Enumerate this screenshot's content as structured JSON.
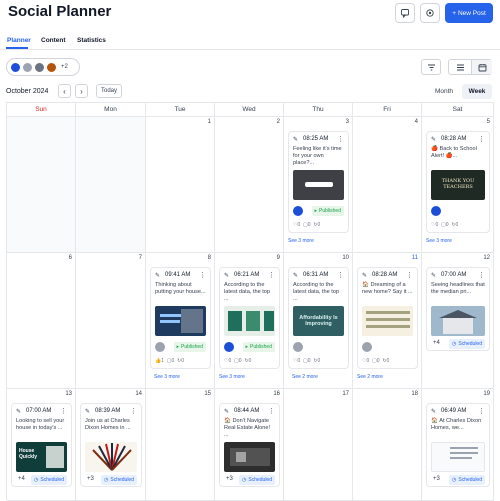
{
  "header": {
    "title": "Social Planner",
    "new_post_label": "New Post"
  },
  "tabs": [
    {
      "label": "Planner"
    },
    {
      "label": "Content"
    },
    {
      "label": "Statistics"
    }
  ],
  "accounts": {
    "more": "+2"
  },
  "calendar": {
    "month_label": "October 2024",
    "today_label": "Today",
    "view_month": "Month",
    "view_week": "Week",
    "days": [
      "Sun",
      "Mon",
      "Tue",
      "Wed",
      "Thu",
      "Fri",
      "Sat"
    ],
    "row1": [
      "",
      "",
      "1",
      "2",
      "3",
      "4",
      "5"
    ],
    "row2": [
      "6",
      "7",
      "8",
      "9",
      "10",
      "11",
      "12"
    ],
    "row3": [
      "13",
      "14",
      "15",
      "16",
      "17",
      "18",
      "19"
    ]
  },
  "posts": {
    "thu3": {
      "time": "08:25 AM",
      "text": "Feeling like it's time for your own place?...",
      "status": "Published",
      "see_more": "See 3 more"
    },
    "sat5": {
      "time": "08:28 AM",
      "text": "🍎 Back to School Alert! 🍎...",
      "image_text": "THANK YOU TEACHERS",
      "see_more": "See 3 more"
    },
    "tue8": {
      "time": "09:41 AM",
      "text": "Thinking about putting your house...",
      "status": "Published",
      "likes": "1",
      "see_more": "See 3 more"
    },
    "wed9": {
      "time": "06:21 AM",
      "text": "According to the latest data, the top ...",
      "status": "Published",
      "see_more": "See 3 more"
    },
    "thu10": {
      "time": "06:31 AM",
      "text": "According to the latest data, the top ...",
      "image_text": "Affordability Is Improving",
      "see_more": "See 2 more"
    },
    "fri11": {
      "time": "08:28 AM",
      "text": "🏠 Dreaming of a new home? Say it ...",
      "see_more": "See 2 more"
    },
    "sat12": {
      "time": "07:00 AM",
      "text": "Seeing headlines that the median pri...",
      "status": "Scheduled",
      "more": "+4"
    },
    "sun13": {
      "time": "07:00 AM",
      "text": "Looking to sell your house in today's ...",
      "image_text": "House Quickly",
      "status": "Scheduled",
      "more": "+4"
    },
    "mon14": {
      "time": "08:39 AM",
      "text": "Join us at Charles Dixon Homes in ...",
      "status": "Scheduled",
      "more": "+3"
    },
    "wed16": {
      "time": "08:44 AM",
      "text": "🏠 Don't Navigate Real Estate Alone! ...",
      "status": "Scheduled",
      "more": "+3"
    },
    "sat19": {
      "time": "06:49 AM",
      "text": "🏠 At Charles Dixon Homes, we...",
      "status": "Scheduled",
      "more": "+3"
    }
  },
  "stat_zero": "0",
  "colors": {
    "accent": "#2563eb",
    "sunday": "#dc2626",
    "published_bg": "#e8f6ea",
    "scheduled_bg": "#e8f0fe"
  }
}
